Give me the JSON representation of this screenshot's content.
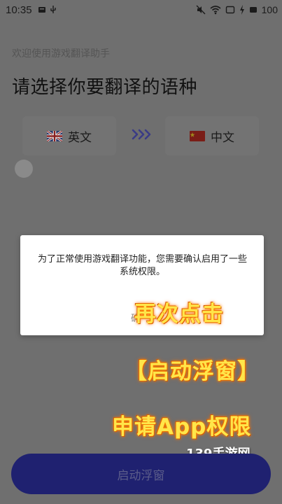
{
  "status_bar": {
    "time": "10:35",
    "battery": "100"
  },
  "subtitle": "欢迎使用游戏翻译助手",
  "heading": "请选择你要翻译的语种",
  "source_language": {
    "label": "英文",
    "flag_icon": "uk-flag-icon"
  },
  "target_language": {
    "label": "中文",
    "flag_icon": "china-flag-icon"
  },
  "swap_icon": "triple-chevron-right-icon",
  "dialog": {
    "message": "为了正常使用游戏翻译功能，您需要确认启用了一些系统权限。",
    "button_partial": "确"
  },
  "overlay": {
    "line1": "再次点击",
    "line2": "【启动浮窗】",
    "line3": "申请App权限"
  },
  "watermark": "139手游网",
  "start_button": "启动浮窗",
  "colors": {
    "dim_background": "#6f6f6f",
    "start_button_bg": "#1f2170",
    "overlay_text": "#ffe64a",
    "overlay_glow": "#ff8a00"
  }
}
